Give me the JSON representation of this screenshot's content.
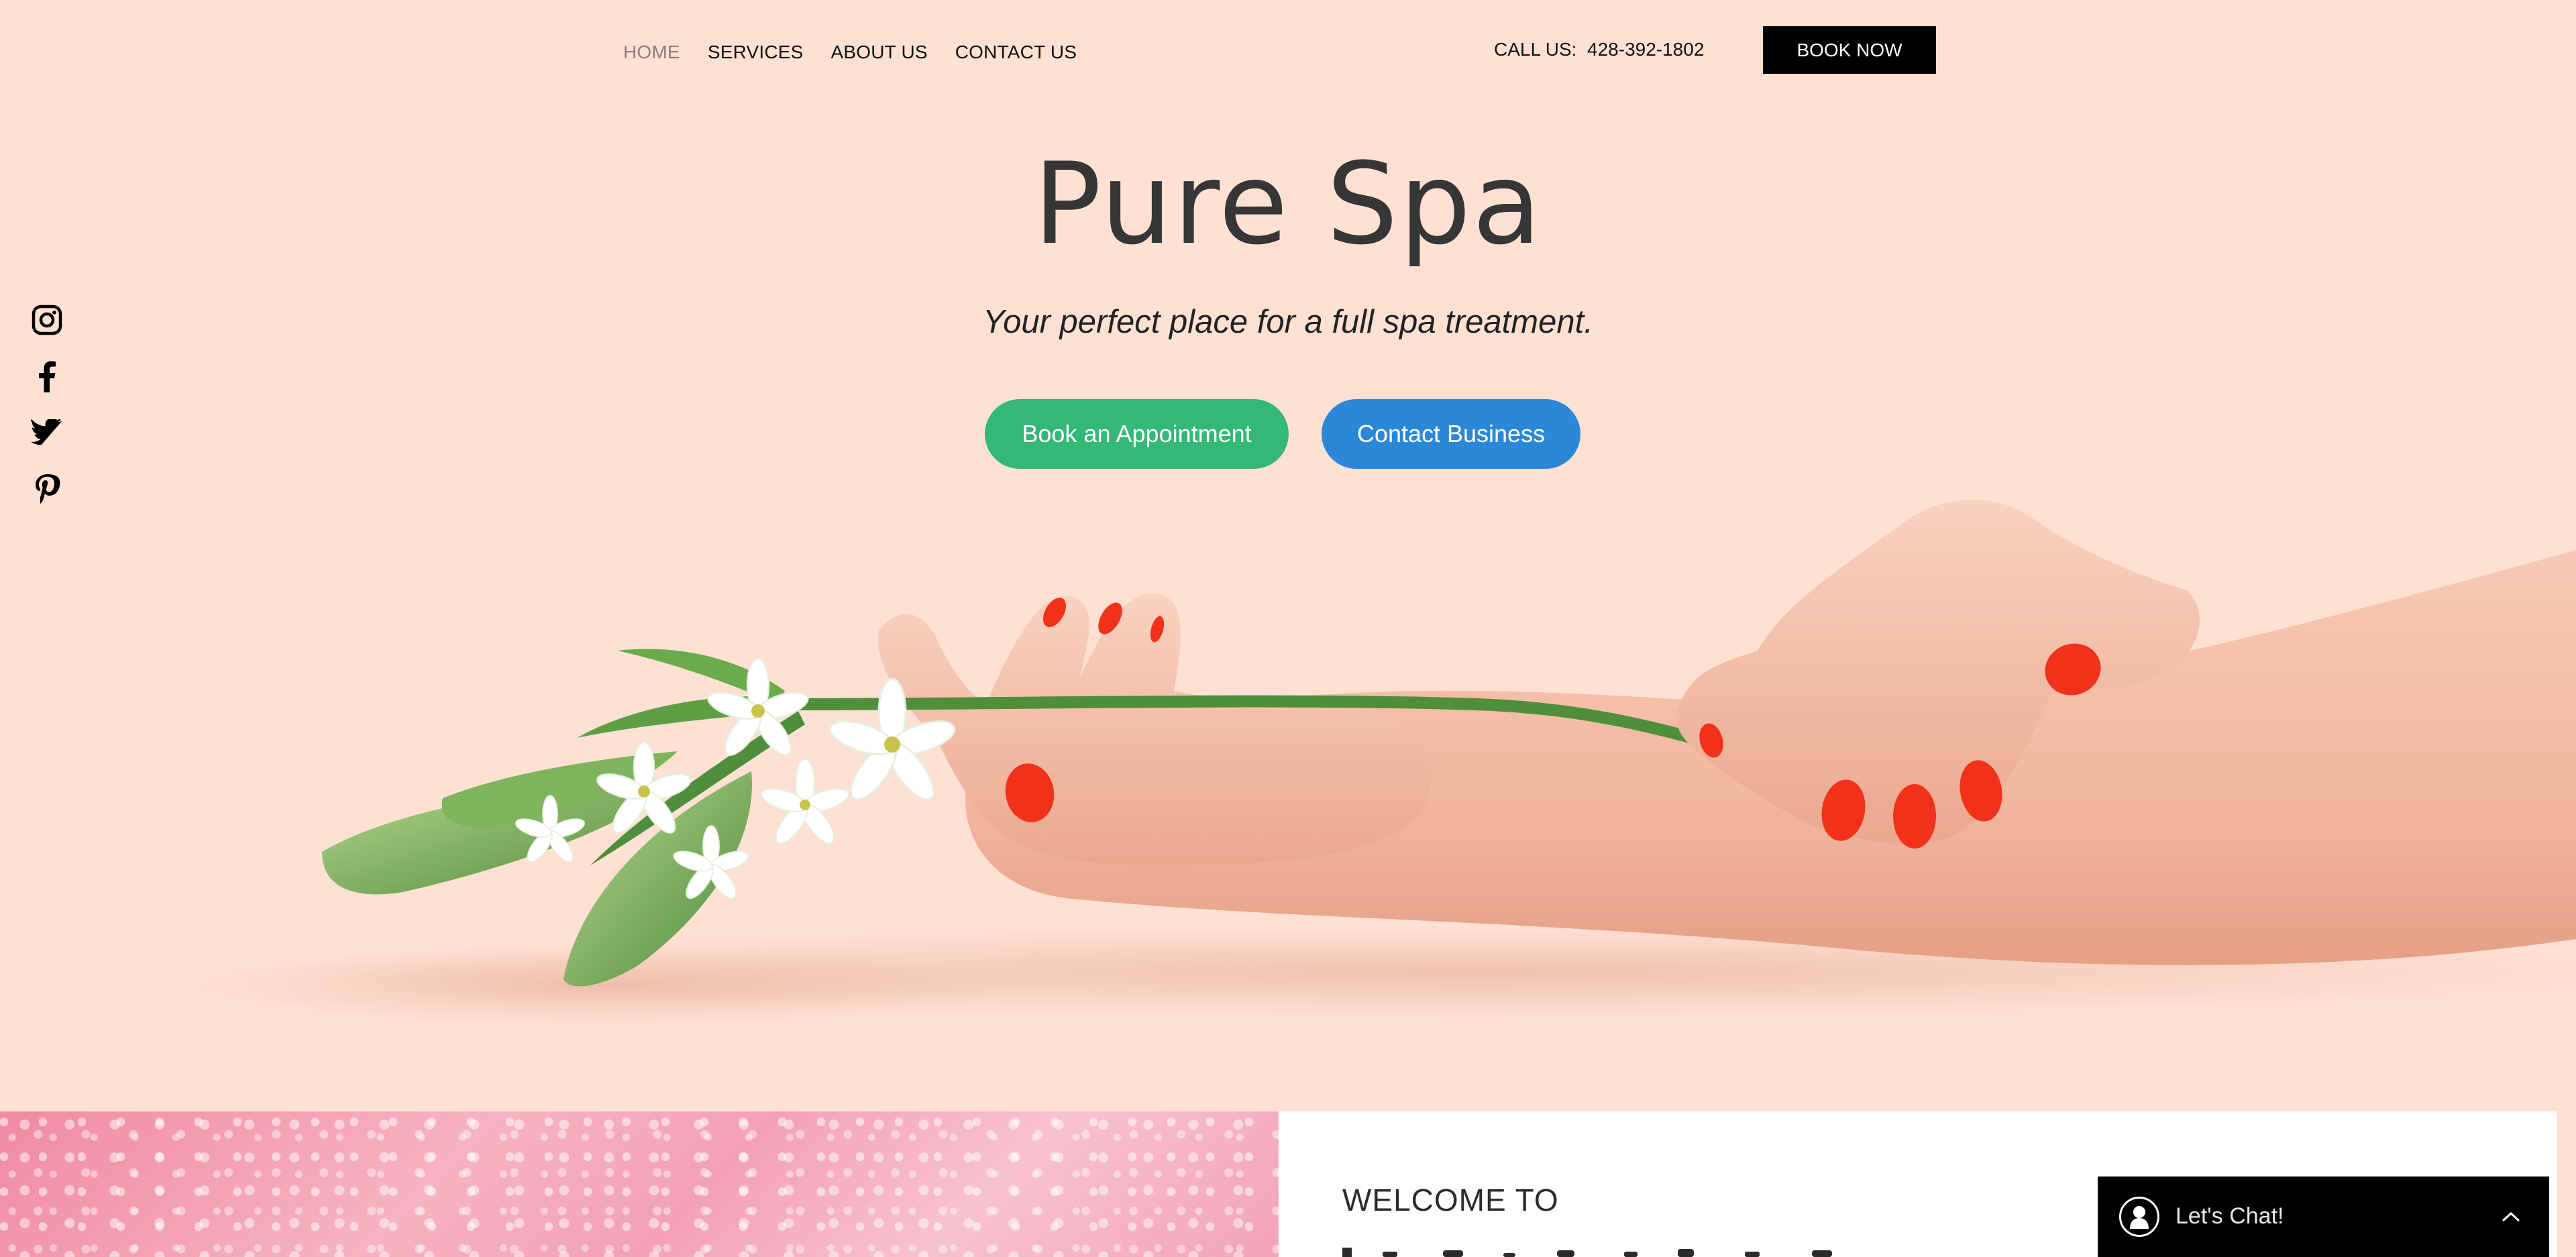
{
  "nav": {
    "items": [
      {
        "label": "HOME",
        "active": true
      },
      {
        "label": "SERVICES",
        "active": false
      },
      {
        "label": "ABOUT US",
        "active": false
      },
      {
        "label": "CONTACT US",
        "active": false
      }
    ]
  },
  "header": {
    "call_label": "CALL US:",
    "phone": "428-392-1802",
    "book_now_label": "BOOK NOW"
  },
  "hero": {
    "title": "Pure Spa",
    "subtitle": "Your perfect place for a full spa treatment.",
    "book_button_label": "Book an Appointment",
    "contact_button_label": "Contact Business"
  },
  "social": {
    "icons": [
      "instagram-icon",
      "facebook-icon",
      "twitter-icon",
      "pinterest-icon"
    ]
  },
  "welcome": {
    "label": "WELCOME TO"
  },
  "chat": {
    "label": "Let's Chat!",
    "icon": "chat-avatar-icon",
    "toggle_icon": "chevron-up-icon"
  },
  "colors": {
    "background": "#ffe1d4",
    "book_button": "#33b877",
    "contact_button": "#2b88d9",
    "header_button": "#000000",
    "title": "#363636",
    "nail_polish": "#f0321a"
  }
}
